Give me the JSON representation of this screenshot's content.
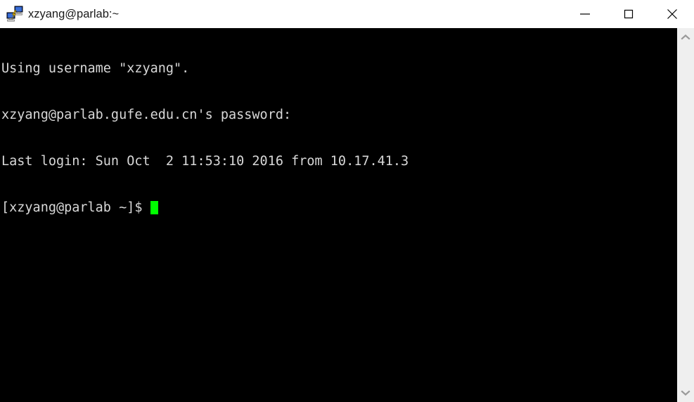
{
  "window": {
    "title": "xzyang@parlab:~",
    "icon": "putty-computers-icon",
    "background_color": "#000000",
    "titlebar_color": "#ffffff"
  },
  "window_controls": {
    "minimize": {
      "name": "minimize-button",
      "glyph": "minimize-icon",
      "label": "Minimize"
    },
    "maximize": {
      "name": "maximize-button",
      "glyph": "maximize-icon",
      "label": "Maximize"
    },
    "close": {
      "name": "close-button",
      "glyph": "close-icon",
      "label": "Close"
    }
  },
  "terminal": {
    "foreground_color": "#d8d8d8",
    "background_color": "#000000",
    "cursor_color": "#00ff00",
    "lines": [
      "Using username \"xzyang\".",
      "xzyang@parlab.gufe.edu.cn's password:",
      "Last login: Sun Oct  2 11:53:10 2016 from 10.17.41.3"
    ],
    "prompt": "[xzyang@parlab ~]$ ",
    "cursor": "block-cursor"
  },
  "scrollbar": {
    "track_color": "#efefef",
    "arrow_color": "#9a9a9a",
    "up_arrow": "chevron-up-icon",
    "down_arrow": "chevron-down-icon"
  }
}
